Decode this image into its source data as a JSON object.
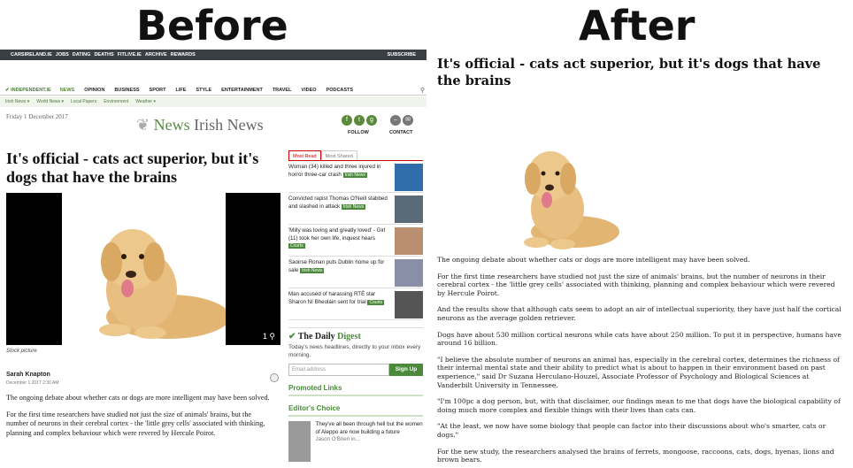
{
  "labels": {
    "before": "Before",
    "after": "After"
  },
  "before": {
    "topbar": [
      "CARSIRELAND.IE",
      "JOBS",
      "DATING",
      "DEATHS",
      "FITLIVE.IE",
      "ARCHIVE",
      "REWARDS"
    ],
    "subscribe": "SUBSCRIBE",
    "logo": "INDEPENDENT.IE",
    "nav": [
      "NEWS",
      "OPINION",
      "BUSINESS",
      "SPORT",
      "LIFE",
      "STYLE",
      "ENTERTAINMENT",
      "TRAVEL",
      "VIDEO",
      "PODCASTS"
    ],
    "subnav": [
      "Irish News ▾",
      "World News ▾",
      "Local Papers",
      "Environment",
      "Weather ▾"
    ],
    "date": "Friday 1 December 2017",
    "masthead_news": "News",
    "masthead_section": "Irish News",
    "follow": "FOLLOW",
    "contact": "CONTACT",
    "headline": "It's official - cats act superior, but it's dogs that have the brains",
    "photo_count": "1",
    "caption": "Stock picture",
    "author": "Sarah Knapton",
    "article_date": "December 1 2017 2:30 AM",
    "body": [
      "The ongoing debate about whether cats or dogs are more intelligent may have been solved.",
      "For the first time researchers have studied not just the size of animals' brains, but the number of neurons in their cerebral cortex - the 'little grey cells' associated with thinking, planning and complex behaviour which were revered by Hercule Poirot."
    ],
    "tabs": [
      "Most Read",
      "Most Shared"
    ],
    "most_read": [
      {
        "text": "Woman (34) killed and three injured in horror three-car crash",
        "badge": "Irish News"
      },
      {
        "text": "Convicted rapist Thomas O'Neill stabbed and slashed in attack",
        "badge": "Irish News"
      },
      {
        "text": "'Milly was loving and greatly loved' - Girl (11) took her own life, inquest hears",
        "badge": "Courts"
      },
      {
        "text": "Saoirse Ronan puts Dublin home up for sale",
        "badge": "Irish News"
      },
      {
        "text": "Man accused of harassing RTÉ star Sharon Ní Bheoláin sent for trial",
        "badge": "Courts"
      }
    ],
    "digest_the": "The Daily",
    "digest_word": "Digest",
    "digest_desc": "Today's news headlines, directly to your inbox every morning.",
    "email_placeholder": "Email address",
    "signup": "Sign Up",
    "promoted": "Promoted Links",
    "editors_choice": "Editor's Choice",
    "ec_text": "They've all been through hell but the women of Aleppo are now building a future",
    "ec_by": "Jason O'Brien in..."
  },
  "after": {
    "headline": "It's official - cats act superior, but it's dogs that have the brains",
    "body": [
      "The ongoing debate about whether cats or dogs are more intelligent may have been solved.",
      "For the first time researchers have studied not just the size of animals' brains, but the number of neurons in their cerebral cortex - the 'little grey cells' associated with thinking, planning and complex behaviour which were revered by Hercule Poirot.",
      "And the results show that although cats seem to adopt an air of intellectual superiority, they have just half the cortical neurons as the average golden retriever.",
      "Dogs have about 530 million cortical neurons while cats have about 250 million. To put it in perspective, humans have around 16 billion.",
      "\"I believe the absolute number of neurons an animal has, especially in the cerebral cortex, determines the richness of their internal mental state and their ability to predict what is about to happen in their environment based on past experience,\" said Dr Suzana Herculano-Houzel, Associate Professor of Psychology and Biological Sciences at Vanderbilt University in Tennessee.",
      "\"I'm 100pc a dog person, but, with that disclaimer, our findings mean to me that dogs have the biological capability of doing much more complex and flexible things with their lives than cats can.",
      "\"At the least, we now have some biology that people can factor into their discussions about who's smarter, cats or dogs.\"",
      "For the new study, the researchers analysed the brains of ferrets, mongoose, raccoons, cats, dogs, hyenas, lions and brown bears."
    ]
  },
  "icons": [
    "logo-icon",
    "search-icon",
    "facebook-icon",
    "twitter-icon",
    "google-plus-icon",
    "contact-icon",
    "mail-icon",
    "dog-photo-icon"
  ]
}
